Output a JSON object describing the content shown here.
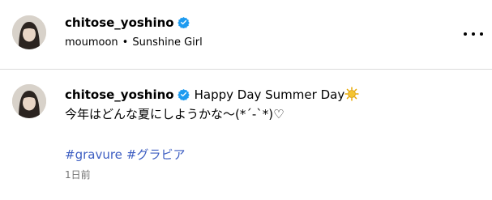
{
  "header": {
    "username": "chitose_yoshino",
    "artist": "moumoon",
    "separator": "•",
    "song": "Sunshine Girl",
    "more_icon": "more-horizontal-icon",
    "verified_icon": "verified-badge-icon"
  },
  "comment": {
    "username": "chitose_yoshino",
    "title": "Happy Day Summer Day",
    "title_icon": "sun-icon",
    "text": "今年はどんな夏にしようかな〜(*´-`*)♡",
    "hashtags": [
      "#gravure",
      "#グラビア"
    ],
    "timestamp": "1日前"
  },
  "colors": {
    "verified": "#1d9bf0",
    "hashtag": "#3d5ec2",
    "timestamp": "#737373",
    "divider": "#dbdbdb",
    "sun": "#f4c430"
  }
}
